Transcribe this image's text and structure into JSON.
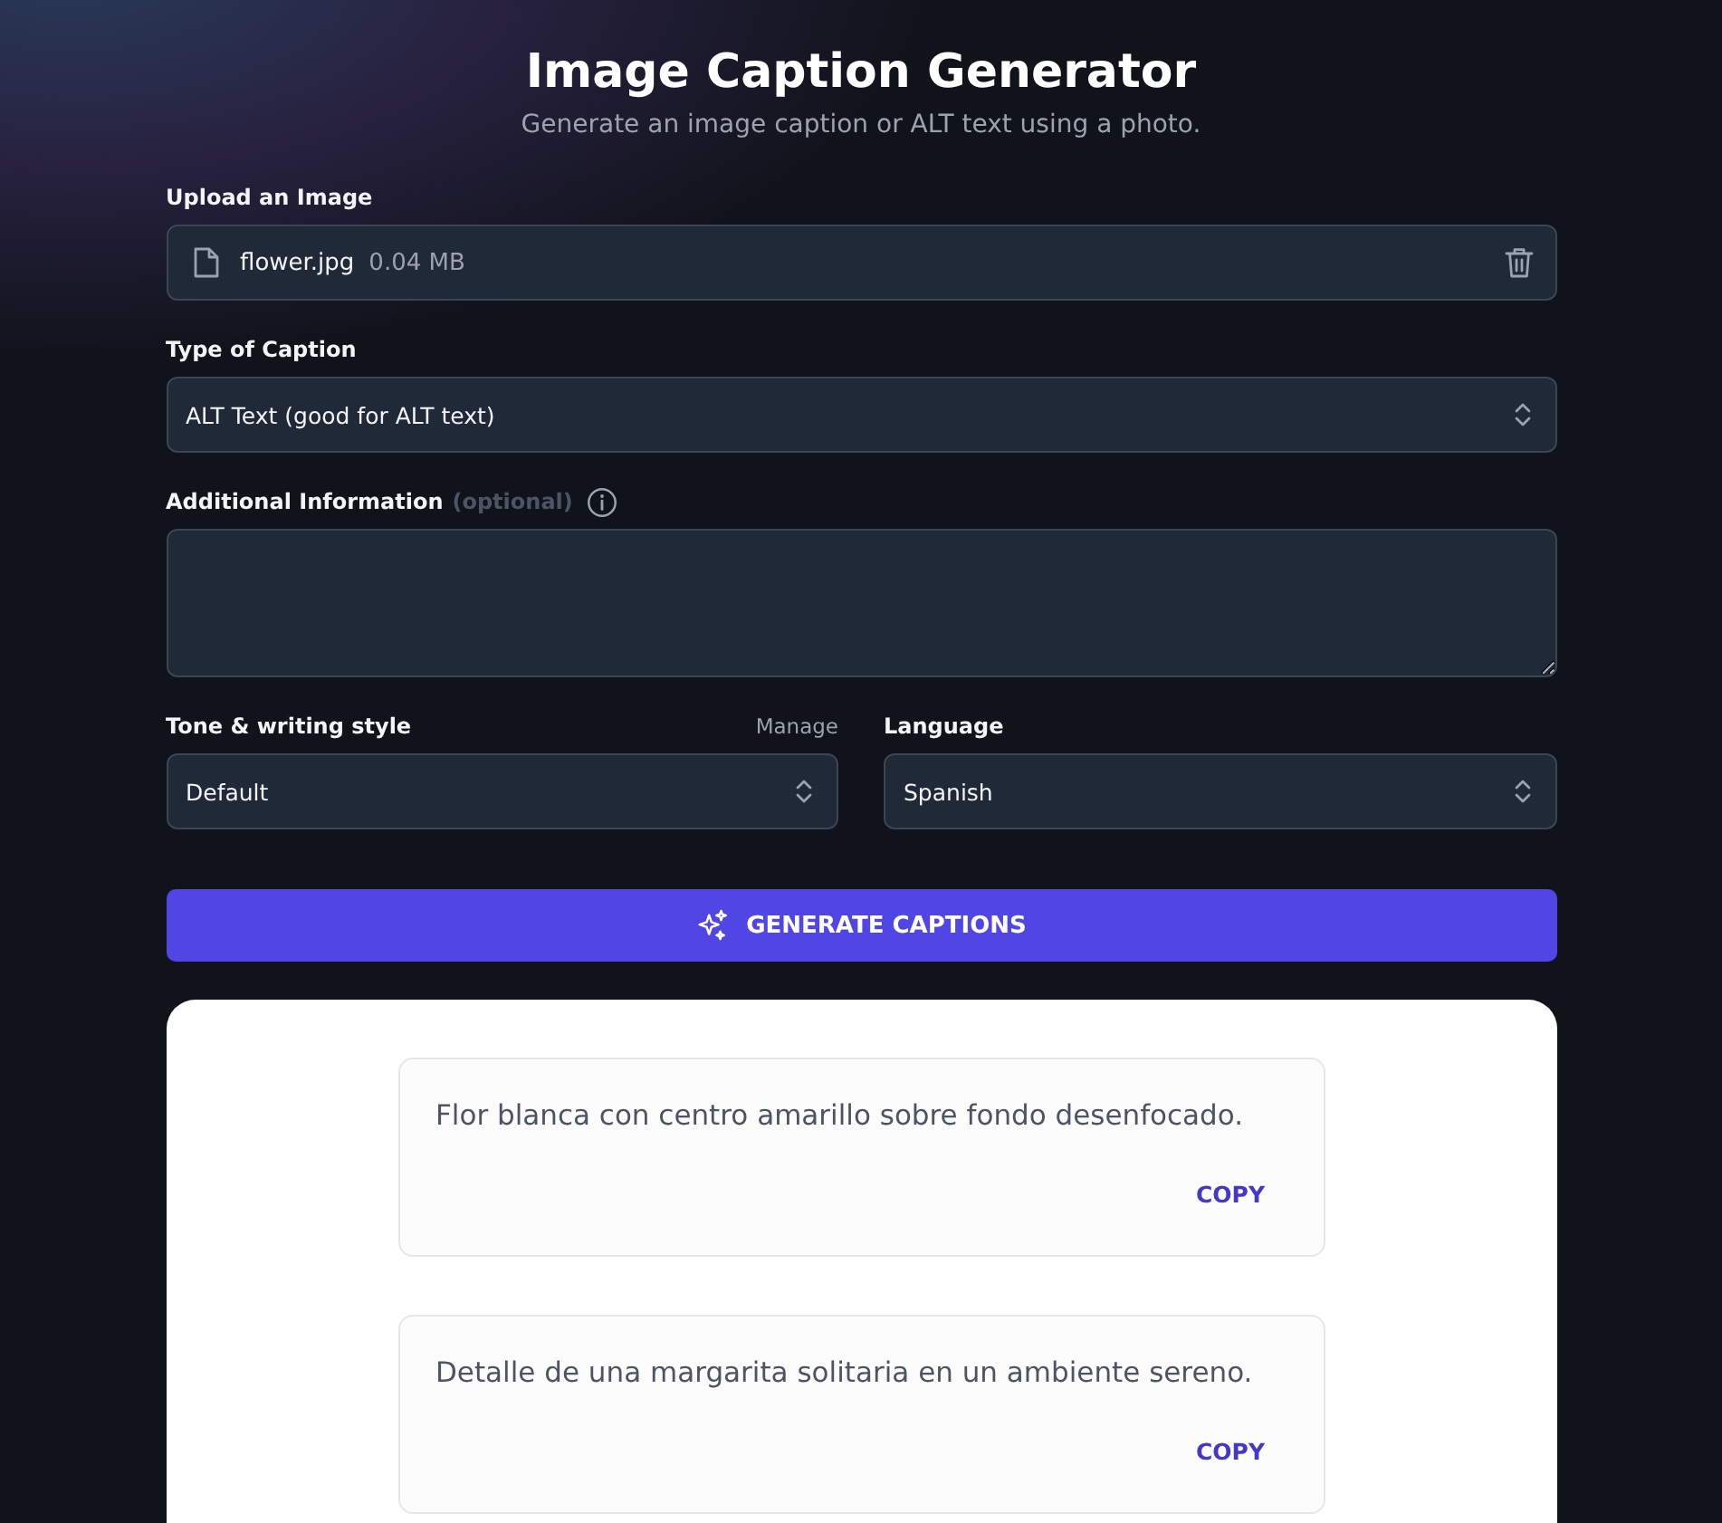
{
  "header": {
    "title": "Image Caption Generator",
    "subtitle": "Generate an image caption or ALT text using a photo."
  },
  "upload": {
    "label": "Upload an Image",
    "file_name": "flower.jpg",
    "file_size": "0.04 MB"
  },
  "caption_type": {
    "label": "Type of Caption",
    "value": "ALT Text (good for ALT text)"
  },
  "additional_info": {
    "label": "Additional Information",
    "optional_note": "(optional)"
  },
  "tone": {
    "label": "Tone & writing style",
    "manage_link": "Manage",
    "value": "Default"
  },
  "language": {
    "label": "Language",
    "value": "Spanish"
  },
  "generate_button": {
    "label": "GENERATE CAPTIONS"
  },
  "results": [
    {
      "text": "Flor blanca con centro amarillo sobre fondo desenfocado.",
      "copy_label": "COPY"
    },
    {
      "text": "Detalle de una margarita solitaria en un ambiente sereno.",
      "copy_label": "COPY"
    }
  ]
}
